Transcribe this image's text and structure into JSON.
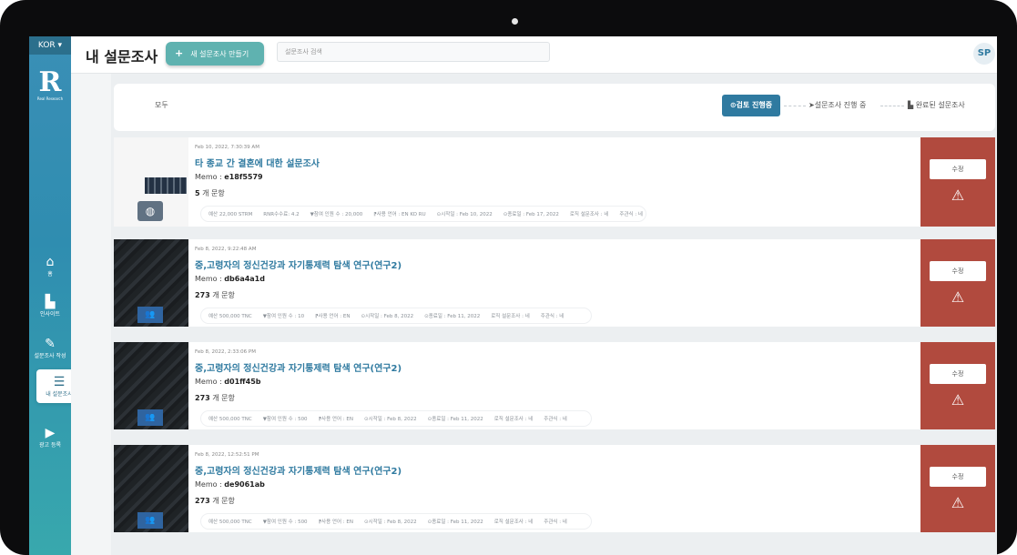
{
  "header": {
    "lang": "KOR ▾",
    "title": "내 설문조사",
    "new_survey": "새 설문조사 만들기",
    "search_placeholder": "설문조사 검색",
    "avatar": "SP"
  },
  "sidebar": {
    "logo_text": "Real Research",
    "items": [
      {
        "label": "홈",
        "icon": "home-icon",
        "glyph": "⌂"
      },
      {
        "label": "인사이트",
        "icon": "insights-icon",
        "glyph": "▙"
      },
      {
        "label": "설문조사 작성",
        "icon": "pencil-icon",
        "glyph": "✎"
      },
      {
        "label": "내 설문조사",
        "icon": "list-icon",
        "glyph": "☰"
      },
      {
        "label": "광고 등록",
        "icon": "play-icon",
        "glyph": "▶"
      }
    ]
  },
  "filters": {
    "all": "모두",
    "review": "⊙검토 진행중",
    "in_progress": "➤설문조사 진행 중",
    "completed": "▙ 완료된 설문조사"
  },
  "surveys": [
    {
      "date": "Feb 10, 2022, 7:30:39 AM",
      "title": "타 종교 간 결혼에 대한 설문조사",
      "memo_label": "Memo : ",
      "memo": "e18f5579",
      "questions_count": "5",
      "questions_suffix": " 개 문항",
      "meta": [
        "예산 22,000 STRM",
        "RNR수수료: 4.2",
        "▼참여 인원 수 : 20,000",
        "⁋사용 언어 : EN KO RU",
        "⊙시작일 : Feb 10, 2022",
        "⊙종료일 : Feb 17, 2022",
        "로직 설문조사 : 네",
        "주관식 : 네"
      ],
      "edit": "수정",
      "badge": "◍"
    },
    {
      "date": "Feb 8, 2022, 9:22:48 AM",
      "title": "중,고령자의 정신건강과 자기통제력 탐색 연구(연구2)",
      "memo_label": "Memo : ",
      "memo": "db6a4a1d",
      "questions_count": "273",
      "questions_suffix": " 개 문항",
      "meta": [
        "예산 500,000 TNC",
        "▼참여 인원 수 : 10",
        "⁋사용 언어 : EN",
        "⊙시작일 : Feb 8, 2022",
        "⊙종료일 : Feb 11, 2022",
        "로직 설문조사 : 네",
        "주관식 : 네"
      ],
      "edit": "수정",
      "badge": "👥"
    },
    {
      "date": "Feb 8, 2022, 2:33:06 PM",
      "title": "중,고령자의 정신건강과 자기통제력 탐색 연구(연구2)",
      "memo_label": "Memo : ",
      "memo": "d01ff45b",
      "questions_count": "273",
      "questions_suffix": " 개 문항",
      "meta": [
        "예산 500,000 TNC",
        "▼참여 인원 수 : 500",
        "⁋사용 언어 : EN",
        "⊙시작일 : Feb 8, 2022",
        "⊙종료일 : Feb 11, 2022",
        "로직 설문조사 : 네",
        "주관식 : 네"
      ],
      "edit": "수정",
      "badge": "👥"
    },
    {
      "date": "Feb 8, 2022, 12:52:51 PM",
      "title": "중,고령자의 정신건강과 자기통제력 탐색 연구(연구2)",
      "memo_label": "Memo : ",
      "memo": "de9061ab",
      "questions_count": "273",
      "questions_suffix": " 개 문항",
      "meta": [
        "예산 500,000 TNC",
        "▼참여 인원 수 : 500",
        "⁋사용 언어 : EN",
        "⊙시작일 : Feb 8, 2022",
        "⊙종료일 : Feb 11, 2022",
        "로직 설문조사 : 네",
        "주관식 : 네"
      ],
      "edit": "수정",
      "badge": "👥"
    }
  ],
  "colors": {
    "accent": "#2f7aa0",
    "danger": "#b14a3e",
    "button": "#5fb2b0"
  }
}
